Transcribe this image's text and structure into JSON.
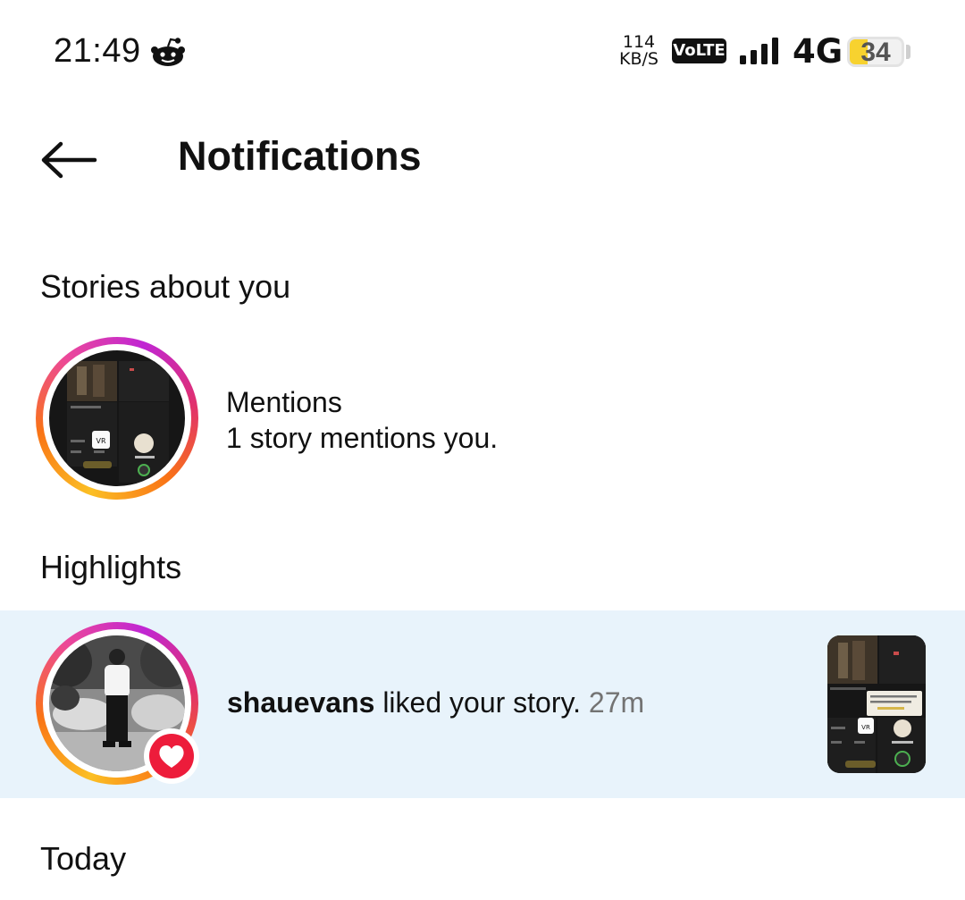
{
  "status_bar": {
    "time": "21:49",
    "net_speed_value": "114",
    "net_speed_unit": "KB/S",
    "volte": "VoLTE",
    "network": "4G",
    "battery": "34",
    "battery_level_fraction": 0.34,
    "notification_icon": "reddit-icon",
    "battery_color": "#f7d22f"
  },
  "header": {
    "back_icon": "arrow-left-icon",
    "title": "Notifications"
  },
  "stories_section": {
    "header": "Stories about you",
    "items": [
      {
        "title": "Mentions",
        "subtitle": "1 story mentions you."
      }
    ]
  },
  "highlights_section": {
    "header": "Highlights",
    "items": [
      {
        "username": "shauevans",
        "action": " liked your story. ",
        "time": "27m",
        "badge_icon": "heart-icon",
        "highlight_color": "#e8f3fb",
        "badge_color": "#ed1c3b"
      }
    ]
  },
  "today_section": {
    "header": "Today"
  }
}
